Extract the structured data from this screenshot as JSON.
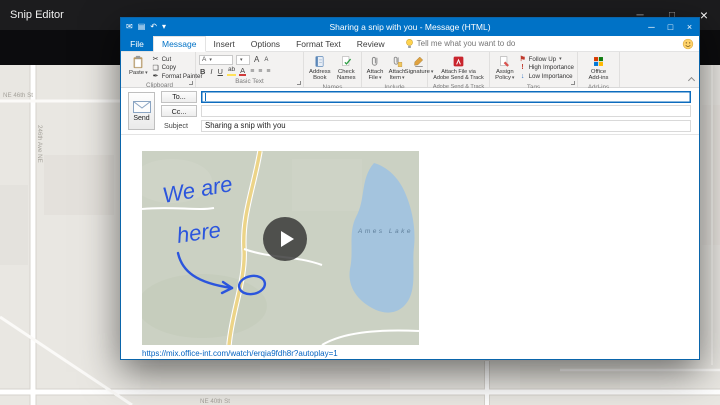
{
  "snip_editor": {
    "title": "Snip Editor"
  },
  "icons": {
    "app": "✉",
    "save": "▤",
    "undo": "↶",
    "qat_menu": "▾",
    "minimize": "─",
    "maximize": "□",
    "close": "×",
    "cut": "✂",
    "copy": "❏",
    "format_painter": "✒",
    "bold": "B",
    "italic": "I",
    "underline": "U",
    "highlight": "ab",
    "font_color": "A",
    "font": "A",
    "grow": "A",
    "shrink": "A",
    "list": "≡",
    "flag": "⚑",
    "high": "!",
    "low": "↓",
    "dropdown": "▾"
  },
  "map": {
    "street_vertical": "246th Ave NE",
    "street_left": "NE 46th St",
    "street_bottom": "NE 40th St"
  },
  "outlook": {
    "title": "Sharing a snip with you - Message (HTML)",
    "tabs": {
      "file": "File",
      "items": [
        "Message",
        "Insert",
        "Options",
        "Format Text",
        "Review"
      ],
      "tell_me": "Tell me what you want to do"
    },
    "ribbon": {
      "clipboard": {
        "label": "Clipboard",
        "paste": "Paste",
        "cut": "Cut",
        "copy": "Copy",
        "format_painter": "Format Painter"
      },
      "basic_text": {
        "label": "Basic Text"
      },
      "names": {
        "label": "Names",
        "address_book": "Address Book",
        "check_names": "Check Names"
      },
      "include": {
        "label": "Include",
        "attach_file": "Attach File",
        "attach_item": "Attach Item",
        "signature": "Signature"
      },
      "adobe": {
        "label": "Adobe Send & Track",
        "button": "Attach File via Adobe Send & Track"
      },
      "tags": {
        "label": "Tags",
        "assign_policy": "Assign Policy",
        "follow_up": "Follow Up",
        "high": "High Importance",
        "low": "Low Importance"
      },
      "addins": {
        "label": "Add-ins",
        "button": "Office Add-ins"
      }
    },
    "compose": {
      "send": "Send",
      "to": "To...",
      "cc": "Cc...",
      "subject_label": "Subject",
      "subject": "Sharing a snip with you",
      "link": "https://mix.office-int.com/watch/erqia9fdh8r?autoplay=1"
    },
    "snip": {
      "ink_line1": "We are",
      "ink_line2": "here",
      "lake": "Ames Lake"
    }
  }
}
